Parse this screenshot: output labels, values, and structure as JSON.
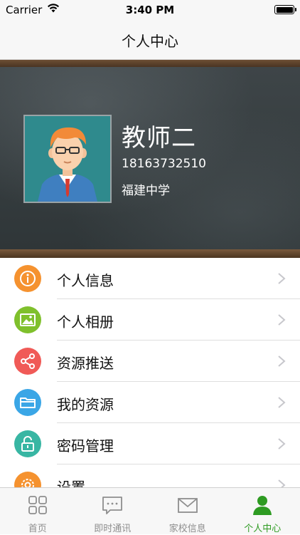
{
  "status_bar": {
    "carrier": "Carrier",
    "time": "3:40 PM"
  },
  "nav": {
    "title": "个人中心"
  },
  "profile": {
    "name": "教师二",
    "phone": "18163732510",
    "school": "福建中学"
  },
  "menu": {
    "items": [
      {
        "label": "个人信息",
        "icon": "info-icon",
        "color": "#f5922f"
      },
      {
        "label": "个人相册",
        "icon": "photo-icon",
        "color": "#7fc02c"
      },
      {
        "label": "资源推送",
        "icon": "share-icon",
        "color": "#f05a57"
      },
      {
        "label": "我的资源",
        "icon": "folder-icon",
        "color": "#3aa6e6"
      },
      {
        "label": "密码管理",
        "icon": "lock-icon",
        "color": "#38b6a3"
      },
      {
        "label": "设置",
        "icon": "gear-icon",
        "color": "#f5922f"
      }
    ]
  },
  "tabbar": {
    "tabs": [
      {
        "label": "首页",
        "icon": "grid-icon"
      },
      {
        "label": "即时通讯",
        "icon": "chat-icon"
      },
      {
        "label": "家校信息",
        "icon": "mail-icon"
      },
      {
        "label": "个人中心",
        "icon": "person-icon",
        "active": true
      }
    ],
    "active_color": "#2e9b22",
    "inactive_color": "#8e8e8e"
  }
}
